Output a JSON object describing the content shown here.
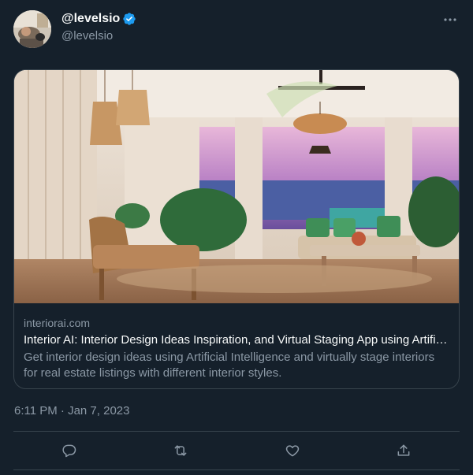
{
  "author": {
    "display_name": "@levelsio",
    "handle": "@levelsio",
    "verified": true
  },
  "icons": {
    "verified": "verified-badge-icon",
    "more": "more-dots-icon",
    "reply": "reply-icon",
    "retweet": "retweet-icon",
    "like": "heart-icon",
    "share": "share-icon"
  },
  "card": {
    "domain": "interiorai.com",
    "title": "Interior AI: Interior Design Ideas Inspiration, and Virtual Staging App using Artifi…",
    "description": "Get interior design ideas using Artificial Intelligence and virtually stage interiors for real estate listings with different interior styles."
  },
  "timestamp": "6:11 PM · Jan 7, 2023",
  "colors": {
    "background": "#15202b",
    "border": "#38444d",
    "text_primary": "#f7f9f9",
    "text_secondary": "#8b98a5",
    "verified": "#1d9bf0"
  }
}
